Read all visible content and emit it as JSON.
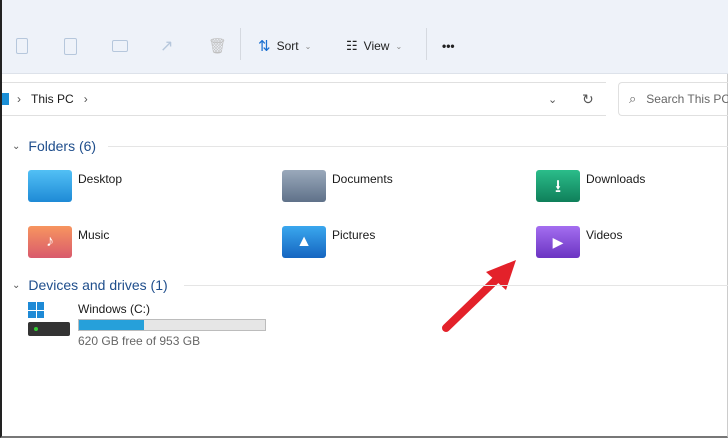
{
  "toolbar": {
    "sort_label": "Sort",
    "view_label": "View",
    "more_label": "•••"
  },
  "address": {
    "crumb": "This PC",
    "search_placeholder": "Search This PC"
  },
  "folders": {
    "header": "Folders (6)",
    "items": [
      {
        "label": "Desktop",
        "color": "#1e90d6"
      },
      {
        "label": "Documents",
        "color": "#6b7f96"
      },
      {
        "label": "Downloads",
        "color": "#17966b"
      },
      {
        "label": "Music",
        "color": "#e8705a"
      },
      {
        "label": "Pictures",
        "color": "#1a7fd0"
      },
      {
        "label": "Videos",
        "color": "#8a4fd6"
      }
    ]
  },
  "drives": {
    "header": "Devices and drives (1)",
    "items": [
      {
        "label": "Windows (C:)",
        "status": "620 GB free of 953 GB",
        "used_fraction": 0.35
      }
    ]
  }
}
